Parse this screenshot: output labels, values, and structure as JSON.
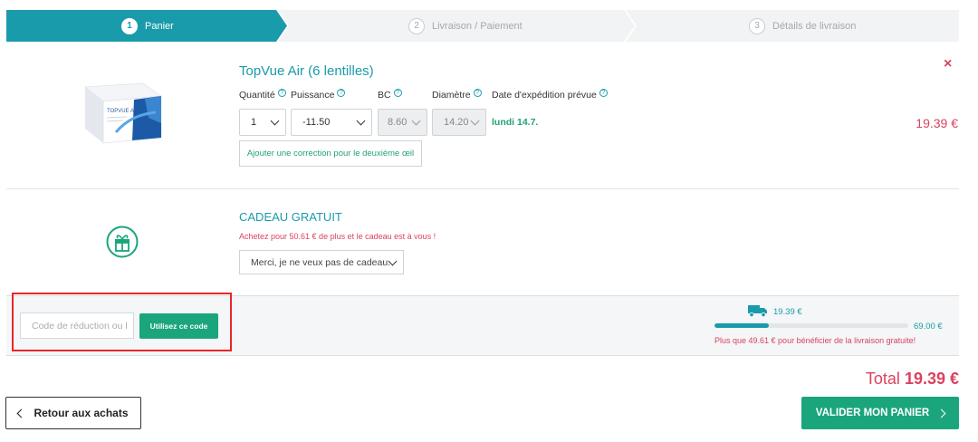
{
  "steps": [
    {
      "num": "1",
      "label": "Panier"
    },
    {
      "num": "2",
      "label": "Livraison / Paiement"
    },
    {
      "num": "3",
      "label": "Détails de livraison"
    }
  ],
  "product": {
    "title": "TopVue Air (6 lentilles)",
    "remove_label": "×",
    "price": "19.39 €",
    "params": {
      "quantity_label": "Quantité",
      "power_label": "Puissance",
      "bc_label": "BC",
      "diameter_label": "Diamètre",
      "ship_date_label": "Date d'expédition prévue"
    },
    "values": {
      "quantity": "1",
      "power": "-11.50",
      "bc": "8.60",
      "diameter": "14.20",
      "ship_date": "lundi 14.7."
    },
    "add_correction_label": "Ajouter une correction pour le deuxième œil",
    "box_brand": "TOPVUE Air"
  },
  "gift": {
    "title": "CADEAU GRATUIT",
    "subtitle": "Achetez pour 50.61 € de plus et le cadeau est à vous !",
    "select_value": "Merci, je ne veux pas de cadeau."
  },
  "promo": {
    "placeholder": "Code de réduction ou l",
    "button_label": "Utilisez ce code"
  },
  "shipping": {
    "current": "19.39 €",
    "goal": "69.00 €",
    "progress": 0.28,
    "message": "Plus que 49.61 € pour bénéficier de la livraison gratuite!"
  },
  "total": {
    "label": "Total",
    "amount": "19.39 €"
  },
  "actions": {
    "back_label": "Retour aux achats",
    "validate_label": "VALIDER MON PANIER"
  },
  "colors": {
    "accent": "#1a9bab",
    "price": "#d9435f",
    "primary_button": "#1aa57d",
    "highlight": "#e8262a"
  }
}
